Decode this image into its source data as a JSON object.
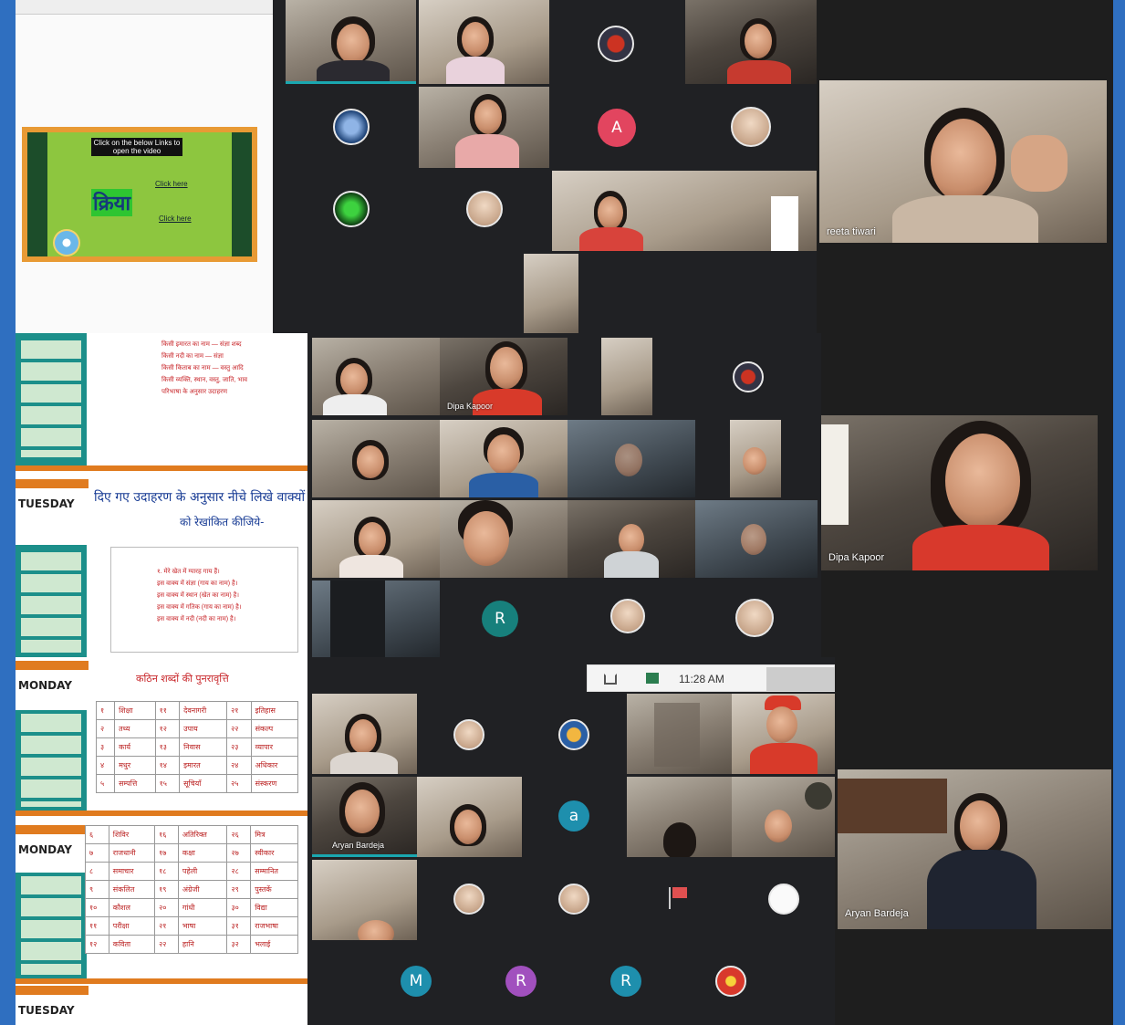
{
  "participants": {
    "meeting1_host": "reeta tiwari",
    "meeting2_host": "Dipa Kapoor",
    "meeting2_tile": "Dipa Kapoor",
    "meeting3_main": "Aryan Bardeja",
    "meeting3_tile": "Aryan Bardeja"
  },
  "avatars": {
    "m1_a": "A",
    "m2_r": "R",
    "m3_a": "a",
    "m3_m": "M",
    "m3_r1": "R",
    "m3_r2": "R"
  },
  "slide": {
    "instruction": "Click on the below Links to open the video",
    "word": "क्रिया",
    "link1": "Click here",
    "link2": "Click here"
  },
  "docs": {
    "day1": "TUESDAY",
    "day2": "MONDAY",
    "day3": "MONDAY",
    "day4": "TUESDAY",
    "heading_mid": "दिए गए उदाहरण के अनुसार नीचे लिखे वाक्यों",
    "heading_mid2": "को रेखांकित कीजिये-",
    "heading_bottom": "कठिन शब्दों की पुनरावृत्ति"
  },
  "taskbar": {
    "time": "11:28 AM"
  },
  "colors": {
    "frame": "#2f6fc0",
    "meet_bg": "#202124",
    "avatar_red": "#e2455f",
    "avatar_teal": "#17807c",
    "avatar_sea": "#1e8fad",
    "avatar_purple": "#a150be",
    "slide_green": "#8dc63f"
  }
}
